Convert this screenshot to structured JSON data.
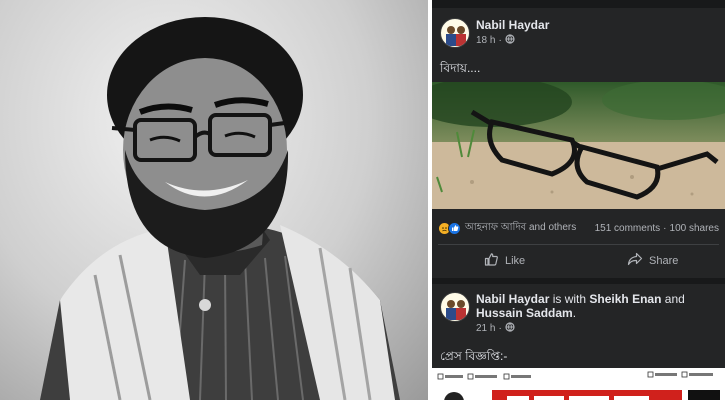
{
  "posts": [
    {
      "author": "Nabil Haydar",
      "time": "18 h",
      "privacy_icon": "globe-icon",
      "text": "বিদায়....",
      "reactions": {
        "icons": [
          "sad-reaction-icon",
          "like-reaction-icon"
        ],
        "names": "আহনাফ আদিব and others",
        "comments": "151 comments",
        "separator": "·",
        "shares": "100 shares"
      },
      "actions": {
        "like": "Like",
        "share": "Share"
      }
    },
    {
      "author": "Nabil Haydar",
      "with_text": "is with",
      "tagged_1": "Sheikh Enan",
      "and_text": "and",
      "tagged_2": "Hussain Saddam",
      "period": ".",
      "time": "21 h",
      "privacy_icon": "globe-icon",
      "text": "প্রেস বিজ্ঞপ্তি:-"
    }
  ],
  "colors": {
    "feed_bg": "#18191a",
    "post_bg": "#242526",
    "text": "#e4e6eb",
    "secondary": "#b0b3b8",
    "like_blue": "#1b74e4"
  }
}
